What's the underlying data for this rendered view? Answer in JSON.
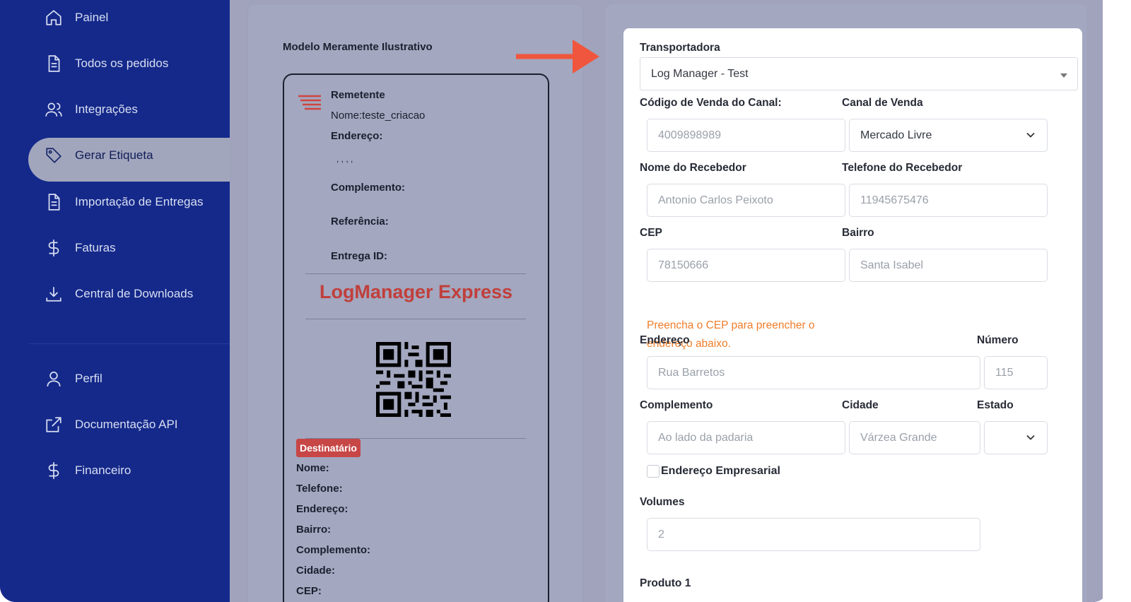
{
  "sidebar": {
    "items": [
      {
        "label": "Painel",
        "icon": "home-icon"
      },
      {
        "label": "Todos os pedidos",
        "icon": "document-icon"
      },
      {
        "label": "Integrações",
        "icon": "users-icon"
      },
      {
        "label": "Gerar Etiqueta",
        "icon": "tag-icon",
        "active": true
      },
      {
        "label": "Importação de Entregas",
        "icon": "document-icon"
      },
      {
        "label": "Faturas",
        "icon": "dollar-icon"
      },
      {
        "label": "Central de Downloads",
        "icon": "download-icon"
      }
    ],
    "bottom_items": [
      {
        "label": "Perfil",
        "icon": "user-icon"
      },
      {
        "label": "Documentação API",
        "icon": "external-link-icon"
      },
      {
        "label": "Financeiro",
        "icon": "dollar-icon"
      }
    ]
  },
  "preview": {
    "title": "Modelo Meramente Ilustrativo",
    "sender_heading": "Remetente",
    "sender_name": "Nome:teste_criacao",
    "sender_address_label": "Endereço:",
    "sender_address_value": ", , , ,",
    "sender_complement_label": "Complemento:",
    "sender_reference_label": "Referência:",
    "delivery_id_label": "Entrega ID:",
    "brand": "LogManager Express",
    "recipient_badge": "Destinatário",
    "recipient_fields": [
      "Nome:",
      "Telefone:",
      "Endereço:",
      "Bairro:",
      "Complemento:",
      "Cidade:",
      "CEP:"
    ]
  },
  "form": {
    "carrier_label": "Transportadora",
    "carrier_value": "Log Manager - Test",
    "sale_code_label": "Código de Venda do Canal:",
    "sale_code_placeholder": "4009898989",
    "sale_channel_label": "Canal de Venda",
    "sale_channel_value": "Mercado Livre",
    "receiver_name_label": "Nome do Recebedor",
    "receiver_name_placeholder": "Antonio Carlos Peixoto",
    "receiver_phone_label": "Telefone do Recebedor",
    "receiver_phone_placeholder": "11945675476",
    "cep_label": "CEP",
    "cep_placeholder": "78150666",
    "district_label": "Bairro",
    "district_placeholder": "Santa Isabel",
    "cep_hint": "Preencha o CEP para preencher o endereço abaixo.",
    "address_label": "Endereço",
    "address_placeholder": "Rua Barretos",
    "number_label": "Número",
    "number_placeholder": "115",
    "complement_label": "Complemento",
    "complement_placeholder": "Ao lado da padaria",
    "city_label": "Cidade",
    "city_placeholder": "Várzea Grande",
    "state_label": "Estado",
    "state_value": "",
    "business_address_label": "Endereço Empresarial",
    "volumes_label": "Volumes",
    "volumes_placeholder": "2",
    "product_label": "Produto 1"
  },
  "colors": {
    "sidebar": "#14298a",
    "overlay": "#a0a3bb",
    "brand_red": "#c13f3b",
    "hint_orange": "#f07d2a",
    "arrow": "#f0563d"
  }
}
